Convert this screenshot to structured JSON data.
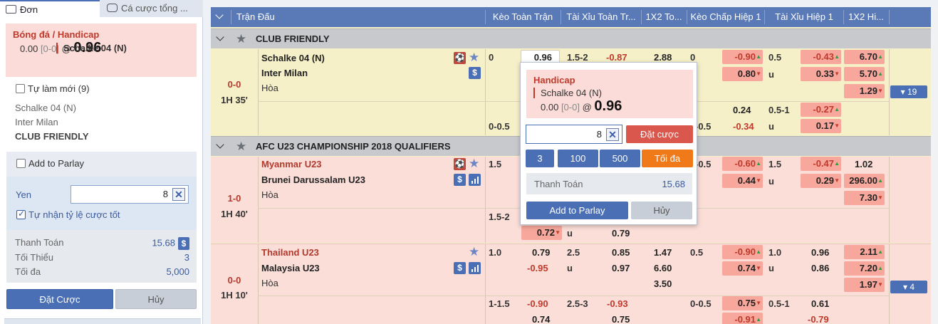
{
  "slip": {
    "tabs": [
      {
        "label": "Đơn"
      },
      {
        "label": "Cá cược tổng ..."
      }
    ],
    "bet": {
      "title": "Bóng đá / Handicap",
      "team": "Schalke 04 (N)",
      "hdp": "0.00",
      "score": "[0-0]",
      "at": "@",
      "odds": "0.96"
    },
    "auto_new_label": "Tự làm mới (9)",
    "info": {
      "home": "Schalke 04 (N)",
      "away": "Inter Milan",
      "league": "CLUB FRIENDLY"
    },
    "parlay_label": "Add to Parlay",
    "currency_label": "Yen",
    "stake_value": "8",
    "accept_better_label": "Tự nhận tỷ lệ cược tốt",
    "summary": [
      {
        "label": "Thanh Toán",
        "value": "15.68"
      },
      {
        "label": "Tối Thiểu",
        "value": "3"
      },
      {
        "label": "Tối đa",
        "value": "5,000"
      }
    ],
    "place_label": "Đặt Cược",
    "cancel_label": "Hủy"
  },
  "table": {
    "headers": [
      "Trận Đấu",
      "Kèo Toàn Trận",
      "Tài Xỉu Toàn Tr...",
      "1X2 To...",
      "Kèo Chấp Hiệp 1",
      "Tài Xỉu Hiệp 1",
      "1X2 Hi..."
    ],
    "leagues": [
      "CLUB FRIENDLY",
      "AFC U23 CHAMPIONSHIP 2018 QUALIFIERS"
    ],
    "matches": [
      {
        "score": "0-0",
        "time": "1H 35'",
        "home": "Schalke 04 (N)",
        "away": "Inter Milan",
        "draw": "Hòa",
        "more": "▾ 19",
        "ft_hdp": "0",
        "ft_home": "0.96",
        "ft_ou": "1.5-2",
        "ft_over": "-0.87",
        "ft_1": "2.88",
        "h1_hdp": "0",
        "h1_home": "-0.90",
        "h1_away": "0.80",
        "h1_ou": "0.5",
        "h1_u": "u",
        "h1_over": "-0.43",
        "h1_under": "0.33",
        "h1_1": "6.70",
        "h1_2": "5.70",
        "h1_x": "1.29",
        "ft_hdp2": "0-0.5",
        "h1_x2a": "0.24",
        "h1_ou2": "0.5-1",
        "h1_over2": "-0.27",
        "h1_hdp2": "-0.5",
        "h1_b2": "-0.34",
        "h1_u2": "u",
        "h1_under2": "0.17"
      },
      {
        "score": "1-0",
        "time": "1H 40'",
        "home": "Myanmar U23",
        "away": "Brunei Darussalam U23",
        "draw": "Hòa",
        "ft_hdp": "1.5",
        "h1_hdp": "-0.5",
        "h1_home": "-0.60",
        "h1_away": "0.44",
        "h1_ou": "1.5",
        "h1_u": "u",
        "h1_over": "-0.47",
        "h1_under": "0.29",
        "h1_1": "1.02",
        "h1_2": "296.00",
        "h1_x": "7.30",
        "ft_hdp2": "1.5-2",
        "ft_b2": "0.72",
        "ft_u2": "u",
        "ft_c2": "0.79"
      },
      {
        "score": "0-0",
        "time": "1H 10'",
        "home": "Thailand U23",
        "away": "Malaysia U23",
        "draw": "Hòa",
        "more": "▾ 4",
        "ft_hdp": "1.0",
        "ft_home": "0.79",
        "ft_away": "-0.95",
        "ft_ou": "2.5",
        "ft_u": "u",
        "ft_over": "0.85",
        "ft_under": "0.97",
        "ft_1": "1.47",
        "ft_2": "6.60",
        "ft_x": "3.50",
        "h1_hdp": "0.5",
        "h1_home": "-0.90",
        "h1_away": "0.74",
        "h1_ou": "1.0",
        "h1_u": "u",
        "h1_over": "0.96",
        "h1_under": "0.86",
        "h1_1": "2.11",
        "h1_2": "7.20",
        "h1_x": "1.97",
        "ft_hdp2": "1-1.5",
        "ft_b2": "-0.90",
        "ft_c2": "0.74",
        "ft_ou2": "2.5-3",
        "ft_d2": "-0.93",
        "ft_e2": "0.75",
        "h1_hdp2": "0-0.5",
        "h1_b2": "0.75",
        "h1_c2": "-0.91",
        "h1_ou2": "0.5-1",
        "h1_d2": "0.61",
        "h1_e2": "-0.79"
      }
    ]
  },
  "popup": {
    "title": "Handicap",
    "team": "Schalke 04 (N)",
    "hdp": "0.00",
    "score": "[0-0]",
    "at": "@",
    "odds": "0.96",
    "stake": "8",
    "place_label": "Đặt cược",
    "quick": [
      "3",
      "100",
      "500"
    ],
    "max_label": "Tối đa",
    "total_label": "Thanh Toán",
    "total_value": "15.68",
    "parlay_label": "Add to Parlay",
    "cancel_label": "Hủy"
  }
}
